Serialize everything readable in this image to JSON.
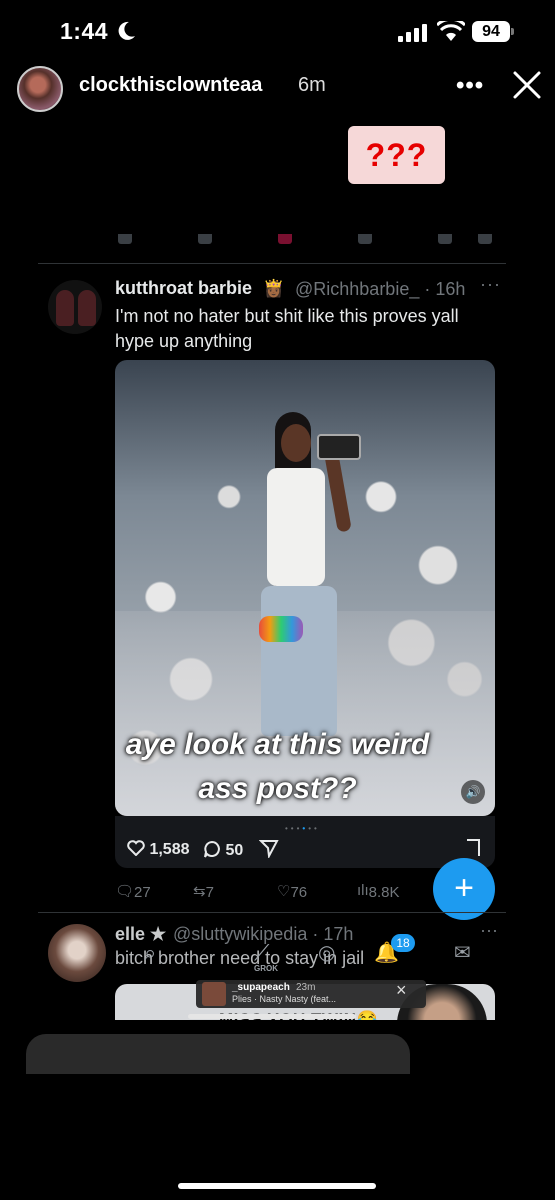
{
  "status_bar": {
    "time": "1:44",
    "battery": "94"
  },
  "story": {
    "username": "clockthisclownteaa",
    "time_ago": "6m",
    "question_sticker": "???",
    "overlay_text_line1": "aye look at this weird",
    "overlay_text_line2": "ass post??"
  },
  "tweet": {
    "name": "kutthroat barbie",
    "name_emoji": "👸🏾",
    "handle_time": "@Richhbarbie_ · 16h",
    "more": "···",
    "text": "I'm not no hater but shit like this proves yall hype up anything",
    "media_likes": "1,588",
    "media_replies": "50",
    "replies": "27",
    "retweets": "7",
    "likes": "76",
    "views": "8.8K",
    "fab_label": "+"
  },
  "next_tweet": {
    "name": "elle",
    "badge": "★",
    "handle_time": "@sluttywikipedia · 17h",
    "more": "···",
    "text": "bitch brother need to stay in jail",
    "media_caption": "MISS YOU TWIN😂",
    "notification_count": "18",
    "grok_label": "GROK"
  },
  "music_sticker": {
    "user": "_supapeach",
    "time": "23m",
    "song": "Plies · Nasty Nasty (feat..."
  },
  "icons": {
    "moon": "moon-icon",
    "signal": "signal-icon",
    "wifi": "wifi-icon",
    "close": "close-icon",
    "heart": "heart-icon",
    "reply": "reply-icon",
    "share": "share-icon",
    "bookmark": "bookmark-icon"
  },
  "colors": {
    "accent": "#1d9bf0",
    "sticker_bg": "#f6d8d8",
    "sticker_text": "#e60000"
  }
}
